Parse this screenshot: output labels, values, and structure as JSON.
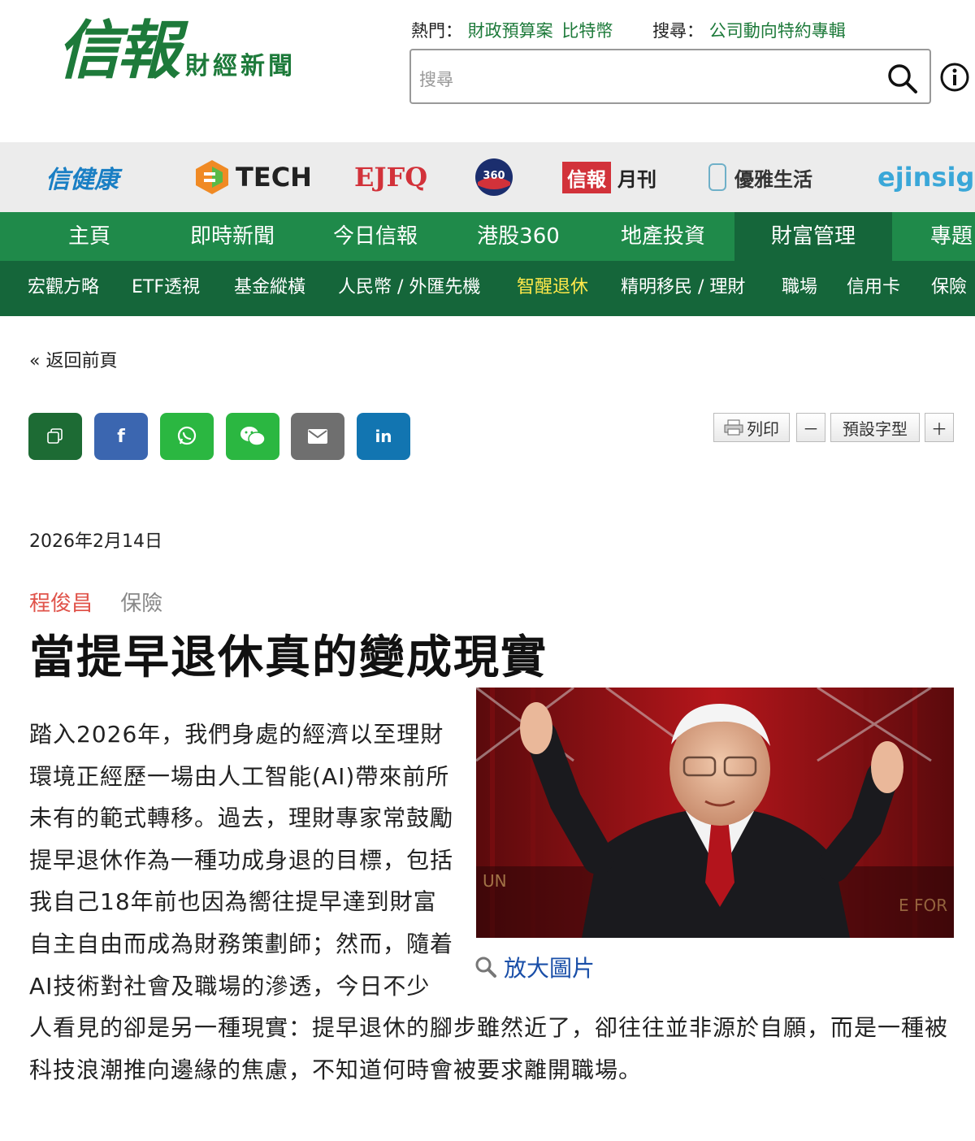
{
  "logo": {
    "main": "信報",
    "sub": "財經新聞"
  },
  "header": {
    "hot_label": "熱門：",
    "hot_links": [
      "財政預算案",
      "比特幣"
    ],
    "search_label": "搜尋：",
    "search_link": "公司動向特約專輯",
    "search_placeholder": "搜尋"
  },
  "brands": [
    "信健康",
    "TECH",
    "EJFQ",
    "港股360",
    "信報",
    "月刊",
    "優雅生活",
    "ejinsight"
  ],
  "main_nav": [
    "主頁",
    "即時新聞",
    "今日信報",
    "港股360",
    "地產投資",
    "財富管理",
    "專題"
  ],
  "main_nav_active": "財富管理",
  "sub_nav": [
    "宏觀方略",
    "ETF透視",
    "基金縱橫",
    "人民幣 / 外匯先機",
    "智醒退休",
    "精明移民 / 理財",
    "職場",
    "信用卡",
    "保險"
  ],
  "sub_nav_active": "智醒退休",
  "back_label": "« 返回前頁",
  "share_buttons": [
    "copy",
    "facebook",
    "whatsapp",
    "wechat",
    "email",
    "linkedin"
  ],
  "share_labels": {
    "facebook": "f",
    "linkedin": "in"
  },
  "tools": {
    "print": "列印",
    "minus": "－",
    "font_default": "預設字型",
    "plus": "＋"
  },
  "article": {
    "date": "2026年2月14日",
    "author": "程俊昌",
    "category": "保險",
    "title": "當提早退休真的變成現實",
    "enlarge_label": "放大圖片",
    "body": "踏入2026年，我們身處的經濟以至理財環境正經歷一場由人工智能(AI)帶來前所未有的範式轉移。過去，理財專家常鼓勵提早退休作為一種功成身退的目標，包括我自己18年前也因為嚮往提早達到財富自主自由而成為財務策劃師；然而，隨着AI技術對社會及職場的滲透，今日不少人看見的卻是另一種現實：提早退休的腳步雖然近了，卻往往並非源於自願，而是一種被科技浪潮推向邊緣的焦慮，不知道何時會被要求離開職場。"
  },
  "colors": {
    "brand_green": "#1f8a4a",
    "dark_green": "#15663a",
    "active_sub": "#ffe94a",
    "author_red": "#e0534a",
    "link_blue": "#1a4fa8"
  }
}
